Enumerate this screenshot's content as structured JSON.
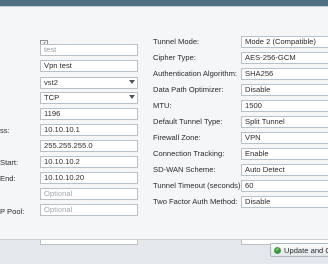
{
  "left_form": {
    "enabled_checked": true,
    "fields": [
      {
        "label": "",
        "value": "test",
        "placeholder": false,
        "type": "text"
      },
      {
        "label": "",
        "value": "Vpn test",
        "placeholder": false,
        "type": "text"
      },
      {
        "label": "",
        "value": "vst2",
        "placeholder": false,
        "type": "select"
      },
      {
        "label": "",
        "value": "TCP",
        "placeholder": false,
        "type": "select"
      },
      {
        "label": "",
        "value": "1196",
        "placeholder": false,
        "type": "text"
      },
      {
        "label": "ss:",
        "value": "10.10.10.1",
        "placeholder": false,
        "type": "text"
      },
      {
        "label": "",
        "value": "255.255.255.0",
        "placeholder": false,
        "type": "text"
      },
      {
        "label": "Start:",
        "value": "10.10.10.2",
        "placeholder": false,
        "type": "text"
      },
      {
        "label": "End:",
        "value": "10.10.10.20",
        "placeholder": false,
        "type": "text"
      },
      {
        "label": "",
        "value": "Optional",
        "placeholder": true,
        "type": "text"
      },
      {
        "label": "P Pool:",
        "value": "Optional",
        "placeholder": true,
        "type": "text"
      }
    ]
  },
  "right_form": {
    "fields": [
      {
        "label": "Tunnel Mode:",
        "value": "Mode 2 (Compatible)"
      },
      {
        "label": "Cipher Type:",
        "value": "AES-256-GCM"
      },
      {
        "label": "Authentication Algorithm:",
        "value": "SHA256"
      },
      {
        "label": "Data Path Optimizer:",
        "value": "Disable"
      },
      {
        "label": "MTU:",
        "value": "1500"
      },
      {
        "label": "Default Tunnel Type:",
        "value": "Split Tunnel"
      },
      {
        "label": "Firewall Zone:",
        "value": "VPN"
      },
      {
        "label": "Connection Tracking:",
        "value": "Enable"
      },
      {
        "label": "SD-WAN Scheme:",
        "value": "Auto Detect"
      },
      {
        "label": "Tunnel Timeout (seconds):",
        "value": "60"
      },
      {
        "label": "Two Factor Auth Method:",
        "value": "Disable"
      }
    ]
  },
  "footer": {
    "update_label": "Update and Close"
  },
  "colors": {
    "header": "#4f6d83",
    "action_icon": "#3f9a3c"
  },
  "icons": {
    "checkbox": "checkmark-icon",
    "select": "chevron-down-icon",
    "update": "check-circle-icon"
  }
}
